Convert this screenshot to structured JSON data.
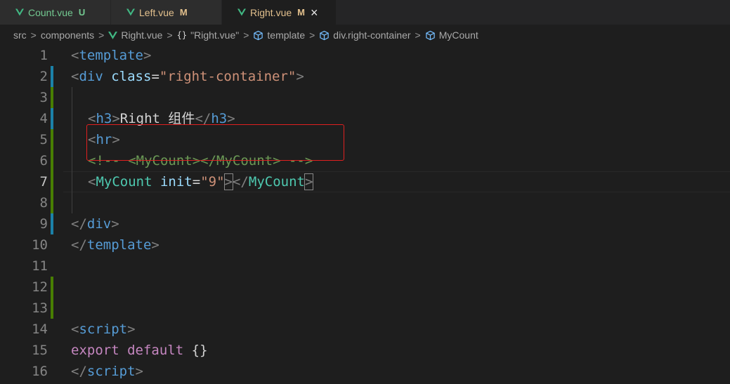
{
  "tabs": [
    {
      "name": "Count.vue",
      "status": "U",
      "name_color": "#73c991",
      "status_color": "#73c991"
    },
    {
      "name": "Left.vue",
      "status": "M",
      "name_color": "#e2c08d",
      "status_color": "#e2c08d"
    },
    {
      "name": "Right.vue",
      "status": "M",
      "name_color": "#e2c08d",
      "status_color": "#e2c08d",
      "close": "×"
    }
  ],
  "breadcrumb": {
    "items": [
      "src",
      "components",
      "Right.vue",
      "\"Right.vue\"",
      "template",
      "div.right-container",
      "MyCount"
    ],
    "separator": ">",
    "braces": "{}"
  },
  "editor": {
    "line_numbers": [
      "1",
      "2",
      "3",
      "4",
      "5",
      "6",
      "7",
      "8",
      "9",
      "10",
      "11",
      "12",
      "13",
      "14",
      "15",
      "16"
    ],
    "current_line": "7",
    "lines": {
      "l1": {
        "lt": "<",
        "tag": "template",
        "gt": ">"
      },
      "l2": {
        "lt": "<",
        "tag": "div",
        "attr": "class",
        "eq": "=",
        "val": "\"right-container\"",
        "gt": ">"
      },
      "l4": {
        "lt": "<",
        "tag": "h3",
        "gt": ">",
        "text": "Right 组件",
        "lt2": "</",
        "tag2": "h3",
        "gt2": ">"
      },
      "l5": {
        "lt": "<",
        "tag": "hr",
        "gt": ">"
      },
      "l6": {
        "comment": "<!-- <MyCount></MyCount> -->"
      },
      "l7": {
        "lt": "<",
        "tag": "MyCount",
        "attr": "init",
        "eq": "=",
        "val": "\"9\"",
        "gt": ">",
        "lt2": "</",
        "tag2": "MyCount",
        "gt2": ">"
      },
      "l9": {
        "lt": "</",
        "tag": "div",
        "gt": ">"
      },
      "l10": {
        "lt": "</",
        "tag": "template",
        "gt": ">"
      },
      "l14": {
        "lt": "<",
        "tag": "script",
        "gt": ">"
      },
      "l15": {
        "kw1": "export",
        "kw2": "default",
        "brace": "{}"
      },
      "l16": {
        "lt": "</",
        "tag": "script",
        "gt": ">"
      }
    }
  },
  "colors": {
    "vue_green": "#41b883",
    "gutter_modified": "#1b81a8",
    "gutter_added": "#487e02",
    "highlight_box": "#e02020"
  }
}
